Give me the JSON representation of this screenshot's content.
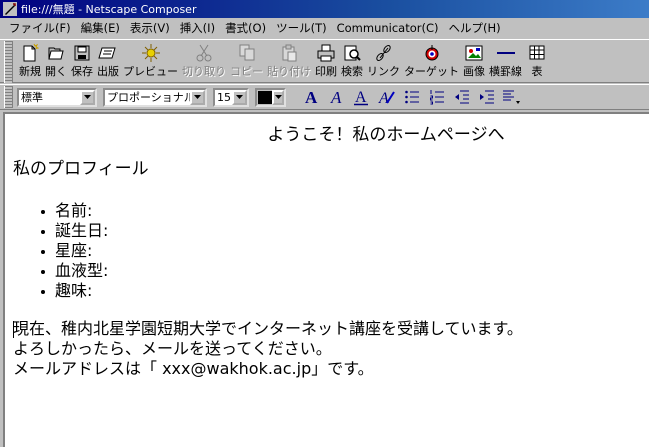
{
  "window": {
    "title": "file:///無題 - Netscape Composer"
  },
  "menu": [
    "ファイル(F)",
    "編集(E)",
    "表示(V)",
    "挿入(I)",
    "書式(O)",
    "ツール(T)",
    "Communicator(C)",
    "ヘルプ(H)"
  ],
  "toolbar": [
    {
      "label": "新規",
      "icon": "new-page-icon",
      "enabled": true
    },
    {
      "label": "開く",
      "icon": "open-icon",
      "enabled": true
    },
    {
      "label": "保存",
      "icon": "save-icon",
      "enabled": true
    },
    {
      "label": "出版",
      "icon": "publish-icon",
      "enabled": true
    },
    {
      "label": "プレビュー",
      "icon": "preview-icon",
      "enabled": true
    },
    {
      "label": "切り取り",
      "icon": "cut-icon",
      "enabled": false
    },
    {
      "label": "コピー",
      "icon": "copy-icon",
      "enabled": false
    },
    {
      "label": "貼り付け",
      "icon": "paste-icon",
      "enabled": false
    },
    {
      "label": "印刷",
      "icon": "print-icon",
      "enabled": true
    },
    {
      "label": "検索",
      "icon": "find-icon",
      "enabled": true
    },
    {
      "label": "リンク",
      "icon": "link-icon",
      "enabled": true
    },
    {
      "label": "ターゲット",
      "icon": "target-icon",
      "enabled": true
    },
    {
      "label": "画像",
      "icon": "image-icon",
      "enabled": true
    },
    {
      "label": "横罫線",
      "icon": "horizontal-rule-icon",
      "enabled": true
    },
    {
      "label": "表",
      "icon": "table-icon",
      "enabled": true
    }
  ],
  "format": {
    "paragraph_style": "標準",
    "font": "プロポーショナル",
    "font_size": "15",
    "text_color": "#000000"
  },
  "document": {
    "heading_center": "ようこそ！私のホームページへ",
    "heading_left": "私のプロフィール",
    "profile_items": [
      "名前:",
      "誕生日:",
      "星座:",
      "血液型:",
      "趣味:"
    ],
    "paragraph_lines": [
      "現在、稚内北星学園短期大学でインターネット講座を受講しています。",
      "よろしかったら、メールを送ってください。",
      "メールアドレスは「 xxx@wakhok.ac.jp」です。"
    ]
  }
}
